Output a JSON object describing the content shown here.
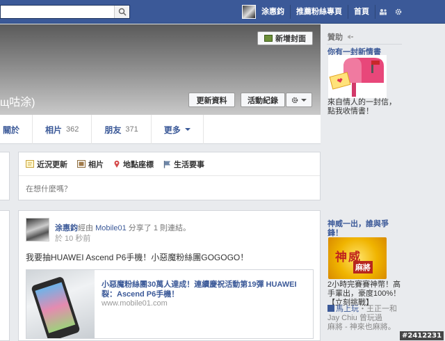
{
  "topbar": {
    "search_placeholder": "",
    "user_name": "涂惠鈞",
    "find_friends": "推薦粉絲專頁",
    "home": "首頁"
  },
  "cover": {
    "add_cover": "新增封面",
    "name_fragment": "щ咕涂)",
    "update_info": "更新資料",
    "activity_log": "活動紀錄"
  },
  "tabs": [
    {
      "label": "關於",
      "count": ""
    },
    {
      "label": "相片",
      "count": "362"
    },
    {
      "label": "朋友",
      "count": "371"
    },
    {
      "label": "更多",
      "count": ""
    }
  ],
  "composer": {
    "tabs": [
      "近況更新",
      "相片",
      "地點座標",
      "生活要事"
    ],
    "placeholder": "在想什麼嗎？"
  },
  "post": {
    "author": "涂惠鈞",
    "via": "經由",
    "app": "Mobile01",
    "action": "分享了 1 則連結。",
    "time": "於 10 秒前",
    "text": "我要抽HUAWEI Ascend P6手機！小惡魔粉絲團GOGOGO！",
    "link_title": "小惡魔粉絲團30萬人達成！連續慶祝活動第19彈 HUAWEI 裂：Ascend P6手機！",
    "link_url": "www.mobile01.com"
  },
  "sidebar": {
    "sponsored": "贊助",
    "ad1_title": "你有一封新情書",
    "ad1_text": "來自情人的一封信，點我收情書！",
    "ad2_title": "神威一出，誰與爭鋒！",
    "ad2_img_text": "神威",
    "ad2_img_sub": "麻將",
    "ad2_text": "2小時完賽賽神幣！高手輩出，豪度100%！【立刻挑戰】",
    "social_app": "馬上玩",
    "social_friends": "王正一和 Jay Chiu 曾玩過",
    "social_game": "麻將 - 神來也麻將。"
  },
  "watermark": "#2412231",
  "colors": {
    "brand": "#3b5998",
    "link": "#3b5998",
    "bg": "#e9ebee"
  }
}
